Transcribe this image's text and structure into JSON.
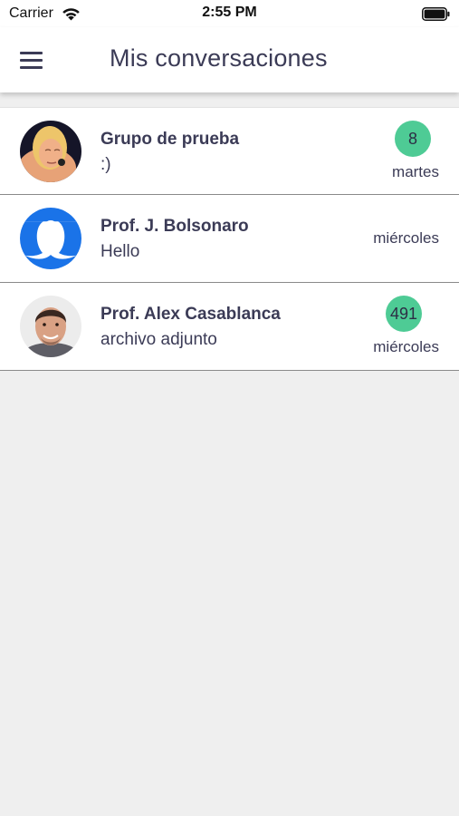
{
  "status_bar": {
    "carrier": "Carrier",
    "time": "2:55 PM",
    "icons": [
      "wifi-icon",
      "battery-icon"
    ]
  },
  "header": {
    "title": "Mis conversaciones",
    "menu_icon": "hamburger-menu-icon"
  },
  "colors": {
    "badge": "#4ecb95",
    "text": "#3b3b56",
    "background": "#efefef",
    "default_avatar": "#1a73e8"
  },
  "conversations": [
    {
      "name": "Grupo de prueba",
      "preview": ":)",
      "badge": "8",
      "time": "martes",
      "avatar": "group-photo-avatar"
    },
    {
      "name": "Prof. J. Bolsonaro",
      "preview": "Hello",
      "badge": "",
      "time": "miércoles",
      "avatar": "default-person-avatar"
    },
    {
      "name": "Prof. Alex Casablanca",
      "preview": "archivo adjunto",
      "badge": "491",
      "time": "miércoles",
      "avatar": "person-photo-avatar"
    }
  ]
}
